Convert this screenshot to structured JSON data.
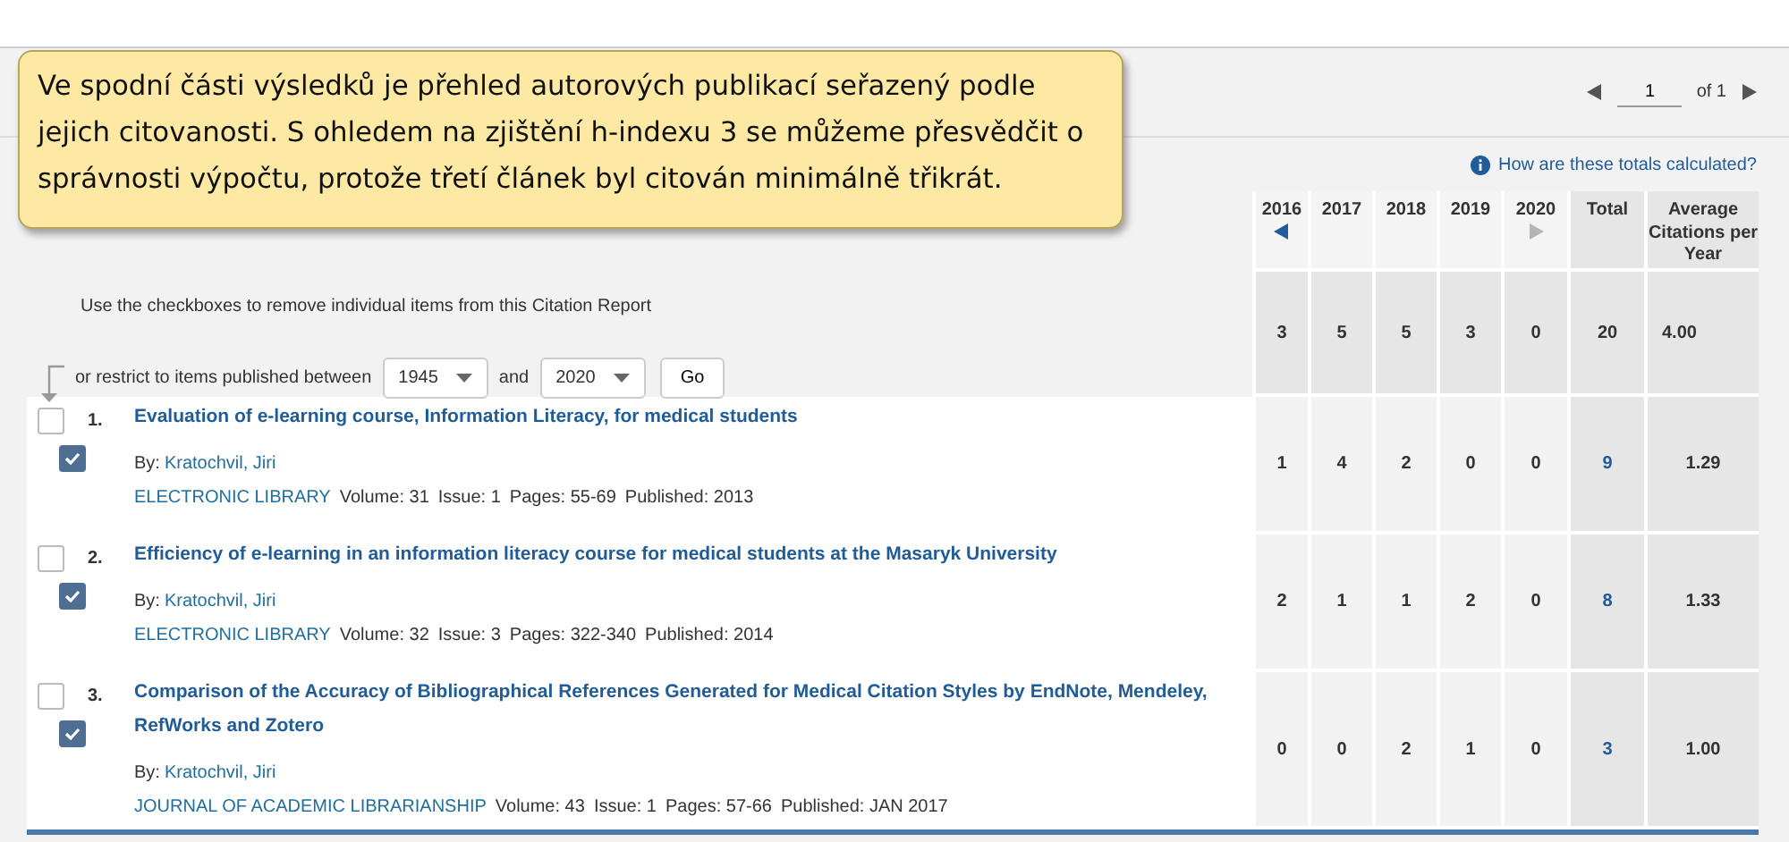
{
  "tooltip": {
    "text": "Ve spodní části výsledků je přehled autorových publikací seřazený podle jejich citovanosti. S ohledem na zjištění h-indexu 3 se můžeme přesvědčit o správnosti výpočtu, protože třetí článek byl citován minimálně třikrát."
  },
  "pager": {
    "page": "1",
    "of_label": "of 1"
  },
  "help_link": "How are these totals calculated?",
  "columns": [
    {
      "label": "2016",
      "kind": "previous",
      "disabled": false
    },
    {
      "label": "2017",
      "kind": "plain"
    },
    {
      "label": "2018",
      "kind": "plain"
    },
    {
      "label": "2019",
      "kind": "plain"
    },
    {
      "label": "2020",
      "kind": "next",
      "disabled": true
    }
  ],
  "total_label": "Total",
  "average_label": "Average Citations per Year",
  "summary": {
    "instructions": "Use the checkboxes to remove individual items from this Citation Report",
    "restrict_label": "or restrict to items published between",
    "from_year": "1945",
    "and_label": "and",
    "to_year": "2020",
    "go_button": "Go",
    "values": [
      "3",
      "5",
      "5",
      "3",
      "0"
    ],
    "total": "20",
    "average": "4.00"
  },
  "rows": [
    {
      "number": "1.",
      "title": "Evaluation of e-learning course, Information Literacy, for medical students",
      "by_label": "By:",
      "author": "Kratochvil, Jiri",
      "source": "ELECTRONIC LIBRARY",
      "details": [
        "Volume: 31",
        "Issue: 1",
        "Pages: 55-69",
        "Published: 2013"
      ],
      "checkboxes": [
        {
          "checked": false
        },
        {
          "checked": true
        }
      ],
      "values": [
        "1",
        "4",
        "2",
        "0",
        "0"
      ],
      "total": "9",
      "average": "1.29"
    },
    {
      "number": "2.",
      "title": "Efficiency of e-learning in an information literacy course for medical students at the Masaryk University",
      "by_label": "By:",
      "author": "Kratochvil, Jiri",
      "source": "ELECTRONIC LIBRARY",
      "details": [
        "Volume: 32",
        "Issue: 3",
        "Pages: 322-340",
        "Published: 2014"
      ],
      "checkboxes": [
        {
          "checked": false
        },
        {
          "checked": true
        }
      ],
      "values": [
        "2",
        "1",
        "1",
        "2",
        "0"
      ],
      "total": "8",
      "average": "1.33"
    },
    {
      "number": "3.",
      "title": "Comparison of the Accuracy of Bibliographical References Generated for Medical Citation Styles by EndNote, Mendeley, RefWorks and Zotero",
      "by_label": "By:",
      "author": "Kratochvil, Jiri",
      "source": "JOURNAL OF ACADEMIC LIBRARIANSHIP",
      "details": [
        "Volume: 43",
        "Issue: 1",
        "Pages: 57-66",
        "Published: JAN 2017"
      ],
      "checkboxes": [
        {
          "checked": false
        },
        {
          "checked": true
        }
      ],
      "values": [
        "0",
        "0",
        "2",
        "1",
        "0"
      ],
      "total": "3",
      "average": "1.00"
    }
  ]
}
